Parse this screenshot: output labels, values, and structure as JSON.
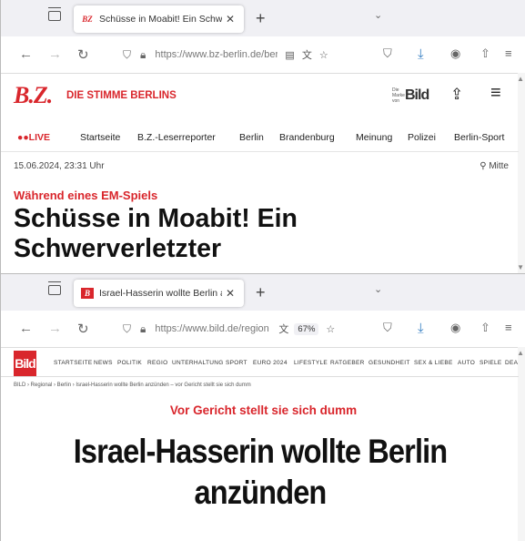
{
  "window1": {
    "tab": {
      "favicon": "BZ",
      "title": "Schüsse in Moabit! Ein Schwerv",
      "close": "✕"
    },
    "newtab": "+",
    "url": "https://www.bz-berlin.de/ber",
    "page": {
      "logo": "B.Z.",
      "claim": "DIE STIMME BERLINS",
      "bild_small": "Die Marke von",
      "bild_word": "Bild",
      "nav": [
        "●●LIVE",
        "Startseite",
        "B.Z.-Leserreporter",
        "Berlin",
        "Brandenburg",
        "Meinung",
        "Polizei",
        "Berlin-Sport"
      ],
      "date": "15.06.2024, 23:31 Uhr",
      "location": "Mitte",
      "kicker": "Während eines EM-Spiels",
      "headline": "Schüsse in Moabit! Ein Schwerverletzter"
    }
  },
  "window2": {
    "tab": {
      "favicon": "B",
      "title": "Israel-Hasserin wollte Berlin an:",
      "close": "✕"
    },
    "newtab": "+",
    "url": "https://www.bild.de/region",
    "zoom": "67%",
    "page": {
      "logo": "Bild",
      "nav": [
        "STARTSEITE",
        "NEWS",
        "POLITIK",
        "REGIO",
        "UNTERHALTUNG",
        "SPORT",
        "EURO 2024",
        "LIFESTYLE",
        "RATGEBER",
        "GESUNDHEIT",
        "SEX & LIEBE",
        "AUTO",
        "SPIELE",
        "DEA"
      ],
      "breadcrumb": "BILD › Regional › Berlin › Israel-Hasserin wollte Berlin anzünden – vor Gericht stellt sie sich dumm",
      "kicker": "Vor Gericht stellt sie sich dumm",
      "headline": "Israel-Hasserin wollte Berlin anzünden"
    }
  },
  "colors": {
    "accent_red": "#d9262c",
    "tabbar": "#f0f0f4"
  }
}
